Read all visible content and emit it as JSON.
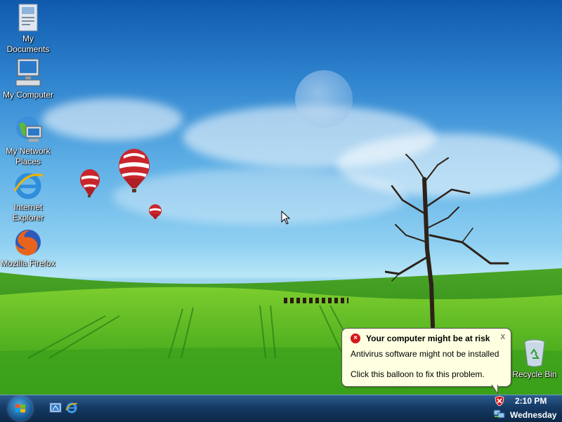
{
  "desktop": {
    "icons": [
      {
        "label": "My Documents",
        "icon": "my-documents-icon"
      },
      {
        "label": "My Computer",
        "icon": "my-computer-icon"
      },
      {
        "label": "My Network Places",
        "icon": "network-places-icon"
      },
      {
        "label": "Internet Explorer",
        "icon": "internet-explorer-icon"
      },
      {
        "label": "Mozilla Firefox",
        "icon": "firefox-icon"
      },
      {
        "label": "Recycle Bin",
        "icon": "recycle-bin-icon"
      }
    ]
  },
  "balloon": {
    "title": "Your computer might be at risk",
    "line1": "Antivirus software might not be installed",
    "line2": "Click this balloon to fix this problem.",
    "close": "x",
    "warning_glyph": "×"
  },
  "taskbar": {
    "start_icon": "windows-start-orb",
    "quick_launch": [
      "show-desktop-icon",
      "internet-explorer-icon"
    ],
    "tray_icons": [
      "security-shield-icon",
      "network-icon"
    ],
    "clock": "2:10 PM",
    "day": "Wednesday"
  },
  "colors": {
    "balloon_bg": "#ffffe1",
    "warning_red": "#d4161b",
    "taskbar_top": "#2c5b8e",
    "taskbar_bottom": "#0c2848"
  }
}
